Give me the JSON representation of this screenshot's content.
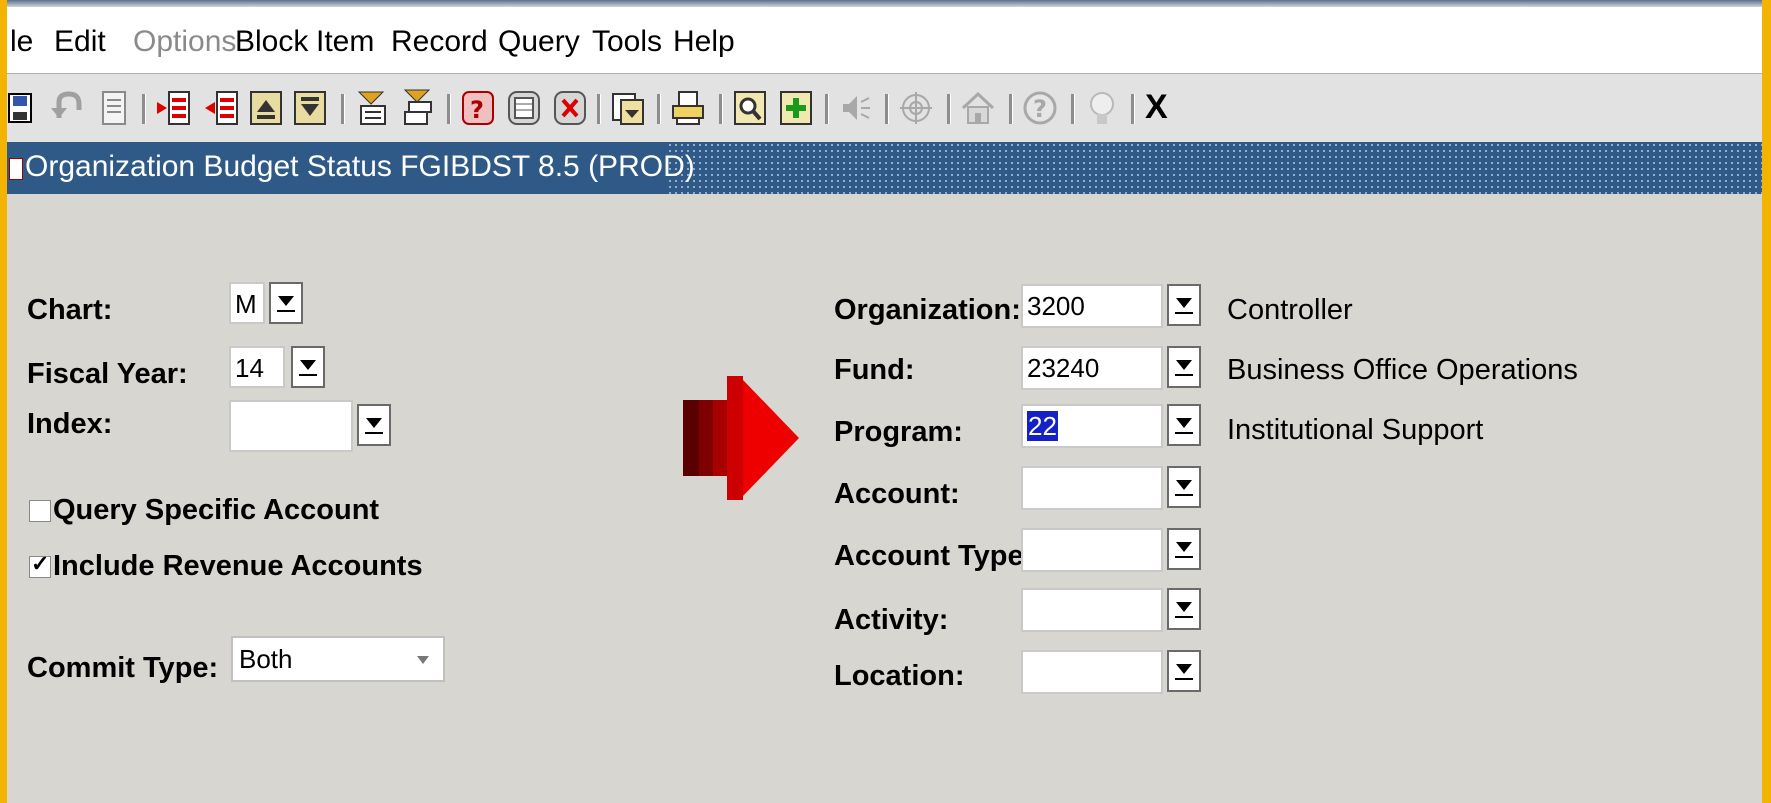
{
  "menu": {
    "items": [
      "le",
      "Edit",
      "Options",
      "Block",
      "Item",
      "Record",
      "Query",
      "Tools",
      "Help"
    ]
  },
  "toolbar": {
    "icons": [
      "save-icon",
      "rollback-icon",
      "print-form-icon",
      "insert-record-icon",
      "remove-record-icon",
      "previous-block-icon",
      "next-block-icon",
      "enter-query-icon",
      "execute-query-icon",
      "help-icon",
      "count-query-icon",
      "cancel-query-icon",
      "options-icon",
      "print-icon",
      "search-icon",
      "add-icon",
      "speaker-icon",
      "target-icon",
      "home-icon",
      "question-icon",
      "lightbulb-icon"
    ],
    "exit_label": "X"
  },
  "window": {
    "title": "Organization Budget Status  FGIBDST  8.5  (PROD)"
  },
  "form": {
    "chart": {
      "label": "Chart:",
      "value": "M"
    },
    "fiscal_year": {
      "label": "Fiscal Year:",
      "value": "14"
    },
    "index": {
      "label": "Index:",
      "value": ""
    },
    "query_specific": {
      "label": "Query Specific Account",
      "checked": false
    },
    "include_revenue": {
      "label": "Include Revenue Accounts",
      "checked": true
    },
    "commit_type": {
      "label": "Commit Type:",
      "value": "Both"
    },
    "organization": {
      "label": "Organization:",
      "value": "3200",
      "desc": "Controller"
    },
    "fund": {
      "label": "Fund:",
      "value": "23240",
      "desc": "Business Office Operations"
    },
    "program": {
      "label": "Program:",
      "value": "22",
      "desc": "Institutional Support"
    },
    "account": {
      "label": "Account:",
      "value": ""
    },
    "account_type": {
      "label": "Account Type:",
      "value": ""
    },
    "activity": {
      "label": "Activity:",
      "value": ""
    },
    "location": {
      "label": "Location:",
      "value": ""
    }
  },
  "colors": {
    "accent_bar": "#f2b400",
    "title_bar": "#2f5a88",
    "arrow": "#e00000",
    "selection": "#1420c8"
  }
}
